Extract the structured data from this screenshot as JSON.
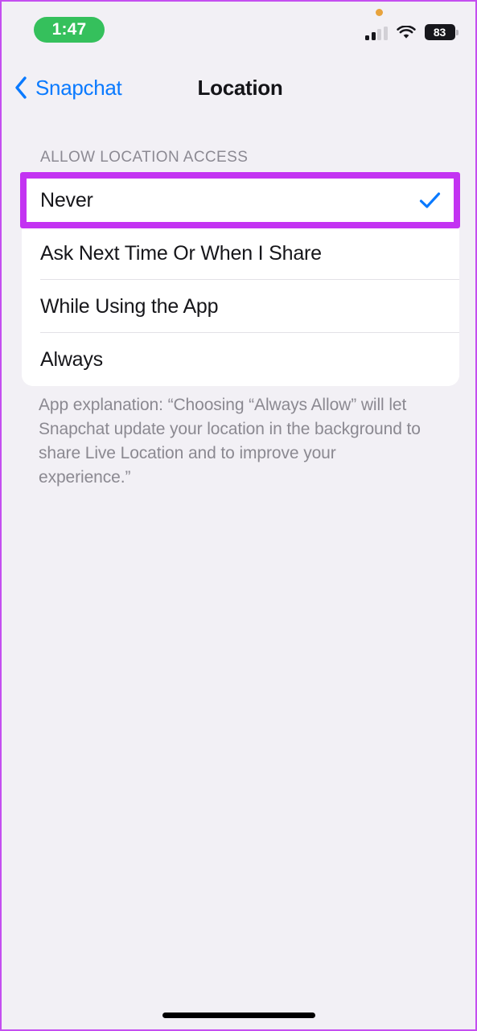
{
  "status_bar": {
    "time": "1:47",
    "time_pill_color": "#35c05c",
    "privacy_indicator": "orange-dot",
    "cellular_bars_filled": 2,
    "cellular_bars_total": 4,
    "wifi": "wifi-icon",
    "battery_percent": "83"
  },
  "nav": {
    "back_label": "Snapchat",
    "back_icon": "chevron-left-icon",
    "title": "Location",
    "accent_color": "#0a7aff"
  },
  "section": {
    "header": "ALLOW LOCATION ACCESS",
    "options": [
      {
        "label": "Never",
        "selected": true
      },
      {
        "label": "Ask Next Time Or When I Share",
        "selected": false
      },
      {
        "label": "While Using the App",
        "selected": false
      },
      {
        "label": "Always",
        "selected": false
      }
    ],
    "check_icon": "checkmark-icon",
    "check_color": "#0a7aff",
    "footer": "App explanation: “Choosing “Always Allow” will let Snapchat update your location in the background to share Live Location and to improve your experience.”"
  },
  "annotation": {
    "highlight_target": "Never",
    "highlight_color": "#c333f2"
  },
  "home_indicator": "home-indicator-bar"
}
